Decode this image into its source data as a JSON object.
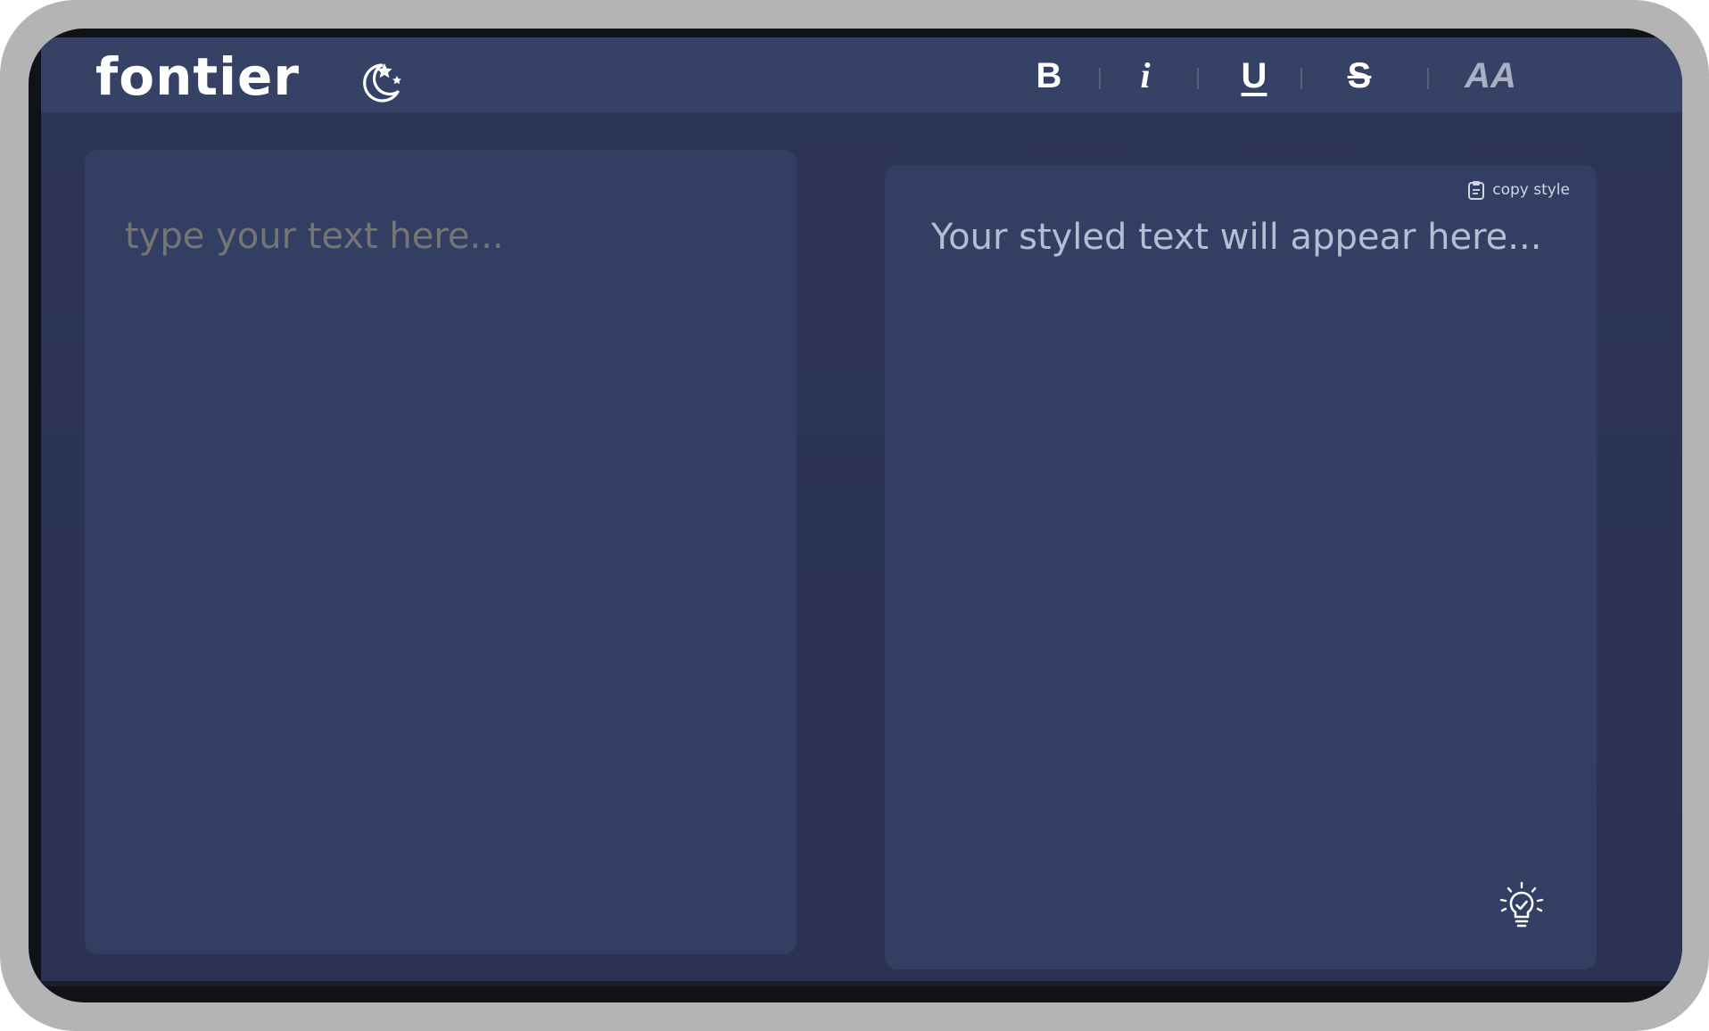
{
  "app": {
    "logo_text": "fontier",
    "theme_toggle_icon": "moon-stars-icon"
  },
  "toolbar": {
    "bold_label": "B",
    "italic_label": "i",
    "underline_label": "U",
    "strikethrough_label": "S",
    "case_label": "AA"
  },
  "input_panel": {
    "placeholder": "type your text here...",
    "value": ""
  },
  "output_panel": {
    "placeholder": "Your styled text will appear here...",
    "copy_label": "copy style",
    "copy_icon": "clipboard-icon",
    "tip_icon": "lightbulb-icon"
  },
  "colors": {
    "background": "#2d3557",
    "header": "#354266",
    "panel": "#323e62",
    "text_muted": "#b6bdd2",
    "text_light": "#ffffff"
  }
}
